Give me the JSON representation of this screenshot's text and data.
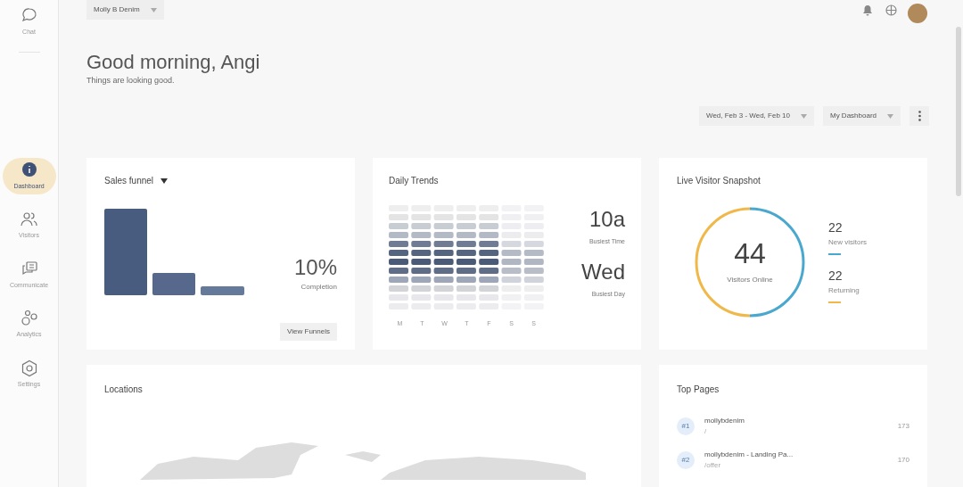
{
  "sidebar": {
    "items": [
      {
        "label": "Chat",
        "selected": false
      },
      {
        "label": "Dashboard",
        "selected": true
      },
      {
        "label": "Visitors",
        "selected": false
      },
      {
        "label": "Communicate",
        "selected": false
      },
      {
        "label": "Analytics",
        "selected": false
      },
      {
        "label": "Settings",
        "selected": false
      }
    ]
  },
  "account_dropdown": {
    "label": "Molly B Denim"
  },
  "greeting": {
    "title": "Good morning, Angi",
    "subtitle": "Things are looking good."
  },
  "date_range": {
    "label": "Wed, Feb 3 - Wed, Feb 10"
  },
  "dashboard_select": {
    "label": "My Dashboard"
  },
  "sales_funnel": {
    "title": "Sales funnel",
    "value": "10%",
    "caption": "Completion",
    "button": "View Funnels"
  },
  "daily_trends": {
    "title": "Daily Trends",
    "days": [
      "M",
      "T",
      "W",
      "T",
      "F",
      "S",
      "S"
    ],
    "stats": [
      {
        "value": "10a",
        "caption": "Busiest Time"
      },
      {
        "value": "Wed",
        "caption": "Busiest Day"
      }
    ]
  },
  "live_visitors": {
    "title": "Live Visitor Snapshot",
    "total": "44",
    "total_caption": "Visitors Online",
    "legend": [
      {
        "value": "22",
        "label": "New visitors",
        "color": "#4aa8cf"
      },
      {
        "value": "22",
        "label": "Returning",
        "color": "#f0b849"
      }
    ]
  },
  "locations": {
    "title": "Locations"
  },
  "top_pages": {
    "title": "Top Pages",
    "rows": [
      {
        "rank": "#1",
        "title": "mollybdenim",
        "path": "/",
        "count": "173"
      },
      {
        "rank": "#2",
        "title": "mollybdenim - Landing Pa...",
        "path": "/offer",
        "count": "170"
      }
    ]
  }
}
